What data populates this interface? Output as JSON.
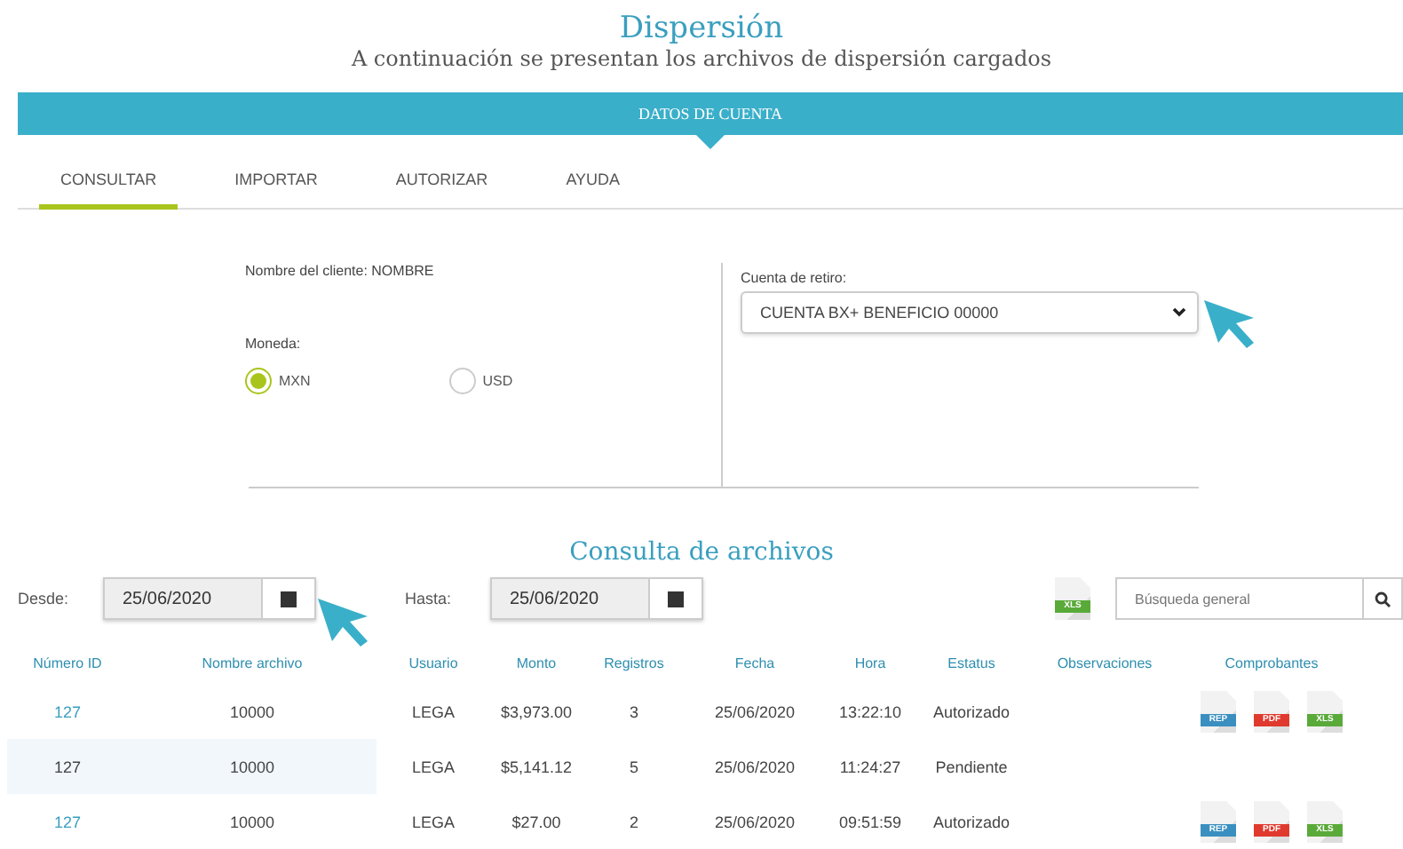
{
  "header": {
    "title": "Dispersión",
    "subtitle": "A continuación se presentan los archivos de dispersión cargados"
  },
  "banner": "DATOS DE CUENTA",
  "tabs": [
    {
      "label": "CONSULTAR",
      "selected": true
    },
    {
      "label": "IMPORTAR",
      "selected": false
    },
    {
      "label": "AUTORIZAR",
      "selected": false
    },
    {
      "label": "AYUDA",
      "selected": false
    }
  ],
  "account": {
    "client_label": "Nombre del cliente:",
    "client_value": "NOMBRE",
    "currency_label": "Moneda:",
    "currencies": [
      {
        "label": "MXN",
        "selected": true
      },
      {
        "label": "USD",
        "selected": false
      }
    ],
    "withdrawal_label": "Cuenta de retiro:",
    "withdrawal_value": "CUENTA BX+ BENEFICIO 00000"
  },
  "query": {
    "title": "Consulta de archivos",
    "from_label": "Desde:",
    "from_value": "25/06/2020",
    "to_label": "Hasta:",
    "to_value": "25/06/2020",
    "export_label": "XLS",
    "search_placeholder": "Búsqueda general"
  },
  "table": {
    "columns": [
      "Número ID",
      "Nombre archivo",
      "Usuario",
      "Monto",
      "Registros",
      "Fecha",
      "Hora",
      "Estatus",
      "Observaciones",
      "Comprobantes"
    ],
    "rows": [
      {
        "linked": true,
        "highlighted": false,
        "cells": [
          "127",
          "10000",
          "LEGA",
          "$3,973.00",
          "3",
          "25/06/2020",
          "13:22:10",
          "Autorizado",
          ""
        ],
        "files": [
          "REP",
          "PDF",
          "XLS"
        ]
      },
      {
        "linked": false,
        "highlighted": true,
        "cells": [
          "127",
          "10000",
          "LEGA",
          "$5,141.12",
          "5",
          "25/06/2020",
          "11:24:27",
          "Pendiente",
          ""
        ],
        "files": []
      },
      {
        "linked": true,
        "highlighted": false,
        "cells": [
          "127",
          "10000",
          "LEGA",
          "$27.00",
          "2",
          "25/06/2020",
          "09:51:59",
          "Autorizado",
          ""
        ],
        "files": [
          "REP",
          "PDF",
          "XLS"
        ]
      }
    ]
  }
}
